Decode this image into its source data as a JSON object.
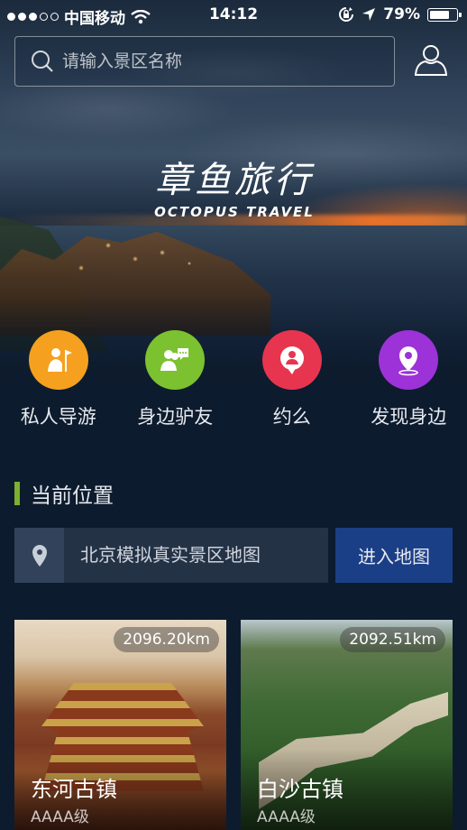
{
  "status_bar": {
    "carrier": "中国移动",
    "time": "14:12",
    "battery": "79%",
    "battery_level": 0.79
  },
  "search": {
    "placeholder": "请输入景区名称"
  },
  "logo": {
    "cn": "章鱼旅行",
    "en": "OCTOPUS TRAVEL"
  },
  "features": [
    {
      "label": "私人导游",
      "color": "#f5a01f",
      "icon": "guide-icon"
    },
    {
      "label": "身边驴友",
      "color": "#7cc12f",
      "icon": "friends-chat-icon"
    },
    {
      "label": "约么",
      "color": "#e8354f",
      "icon": "chat-bubble-icon"
    },
    {
      "label": "发现身边",
      "color": "#9c32d8",
      "icon": "location-pin-icon"
    }
  ],
  "current_location": {
    "section_title": "当前位置",
    "location_text": "北京模拟真实景区地图",
    "enter_map_label": "进入地图"
  },
  "scenic_spots": [
    {
      "name": "东河古镇",
      "grade": "AAAA级",
      "distance": "2096.20km"
    },
    {
      "name": "白沙古镇",
      "grade": "AAAA级",
      "distance": "2092.51km"
    }
  ],
  "colors": {
    "background": "#0d1b2e",
    "section_accent": "#7db02e",
    "enter_map_button": "#1b3f86",
    "location_bar": "#243245"
  }
}
